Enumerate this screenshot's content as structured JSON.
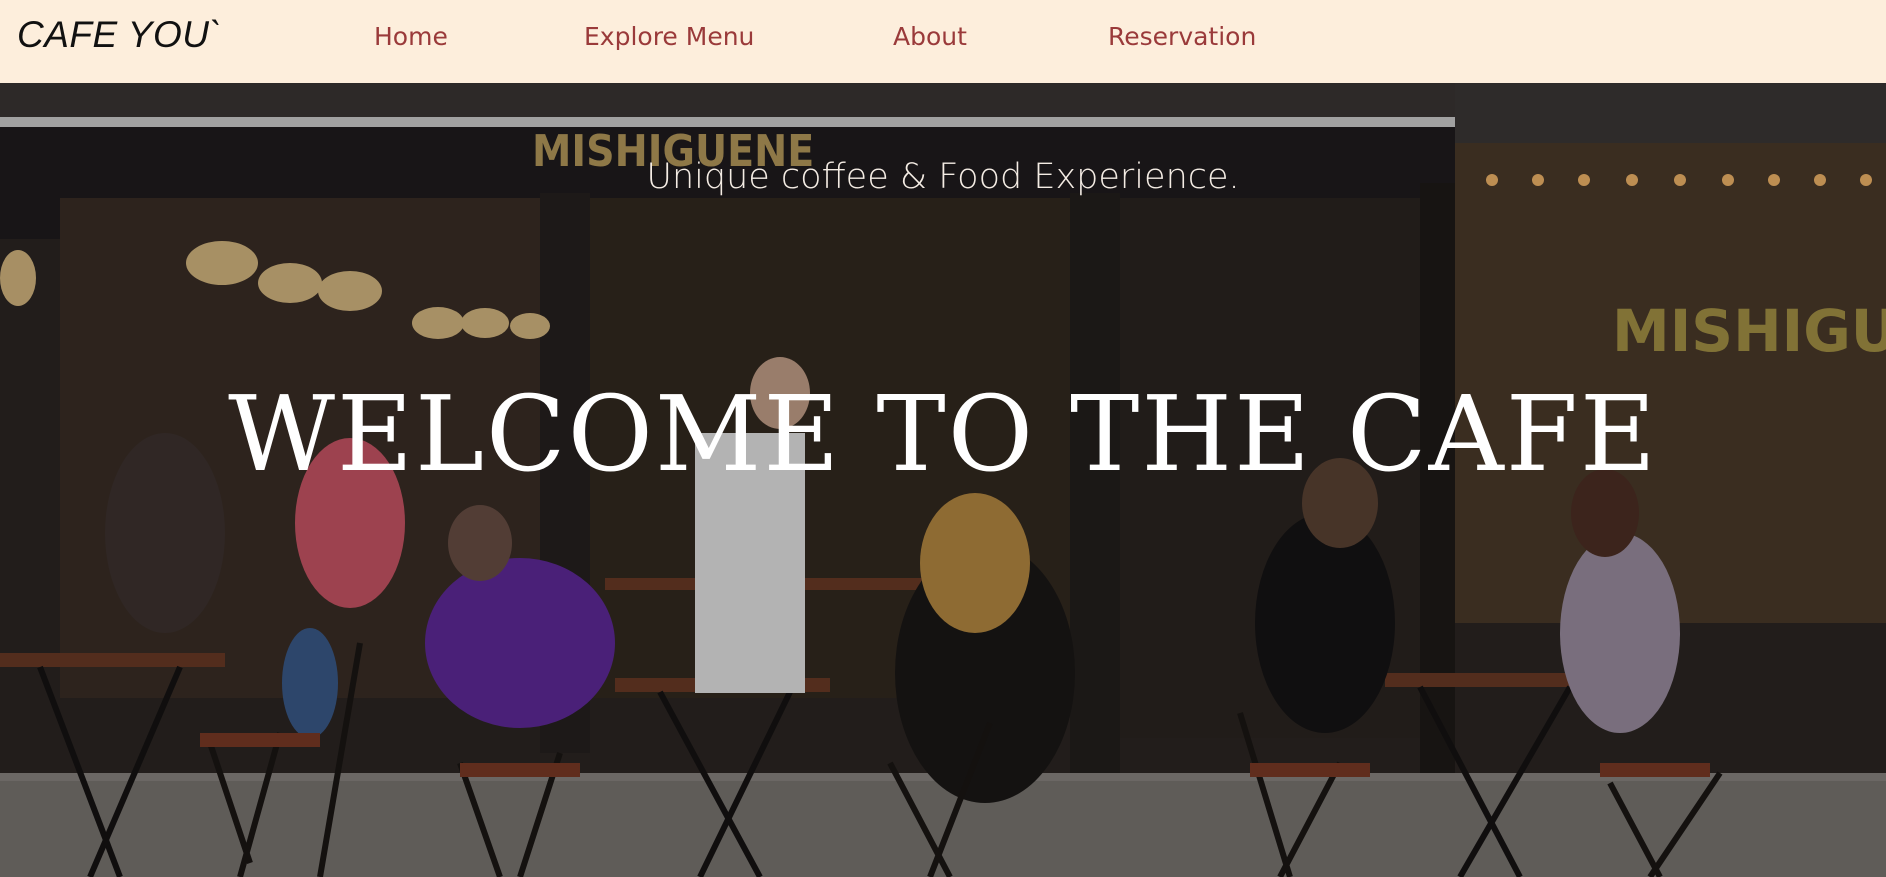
{
  "navbar": {
    "brand": "CAFE YOU`",
    "links": [
      {
        "label": "Home"
      },
      {
        "label": "Explore Menu"
      },
      {
        "label": "About"
      },
      {
        "label": "Reservation"
      }
    ]
  },
  "hero": {
    "tagline": "Unique coffee & Food Experience.",
    "title": "WELCOME TO THE CAFE",
    "image_description": "cafe-terrace-photo",
    "storefront_sign": "MISHIGUENE"
  },
  "colors": {
    "nav_background": "#fdeedc",
    "nav_link": "#9a3a3a",
    "hero_text": "#ffffff"
  }
}
